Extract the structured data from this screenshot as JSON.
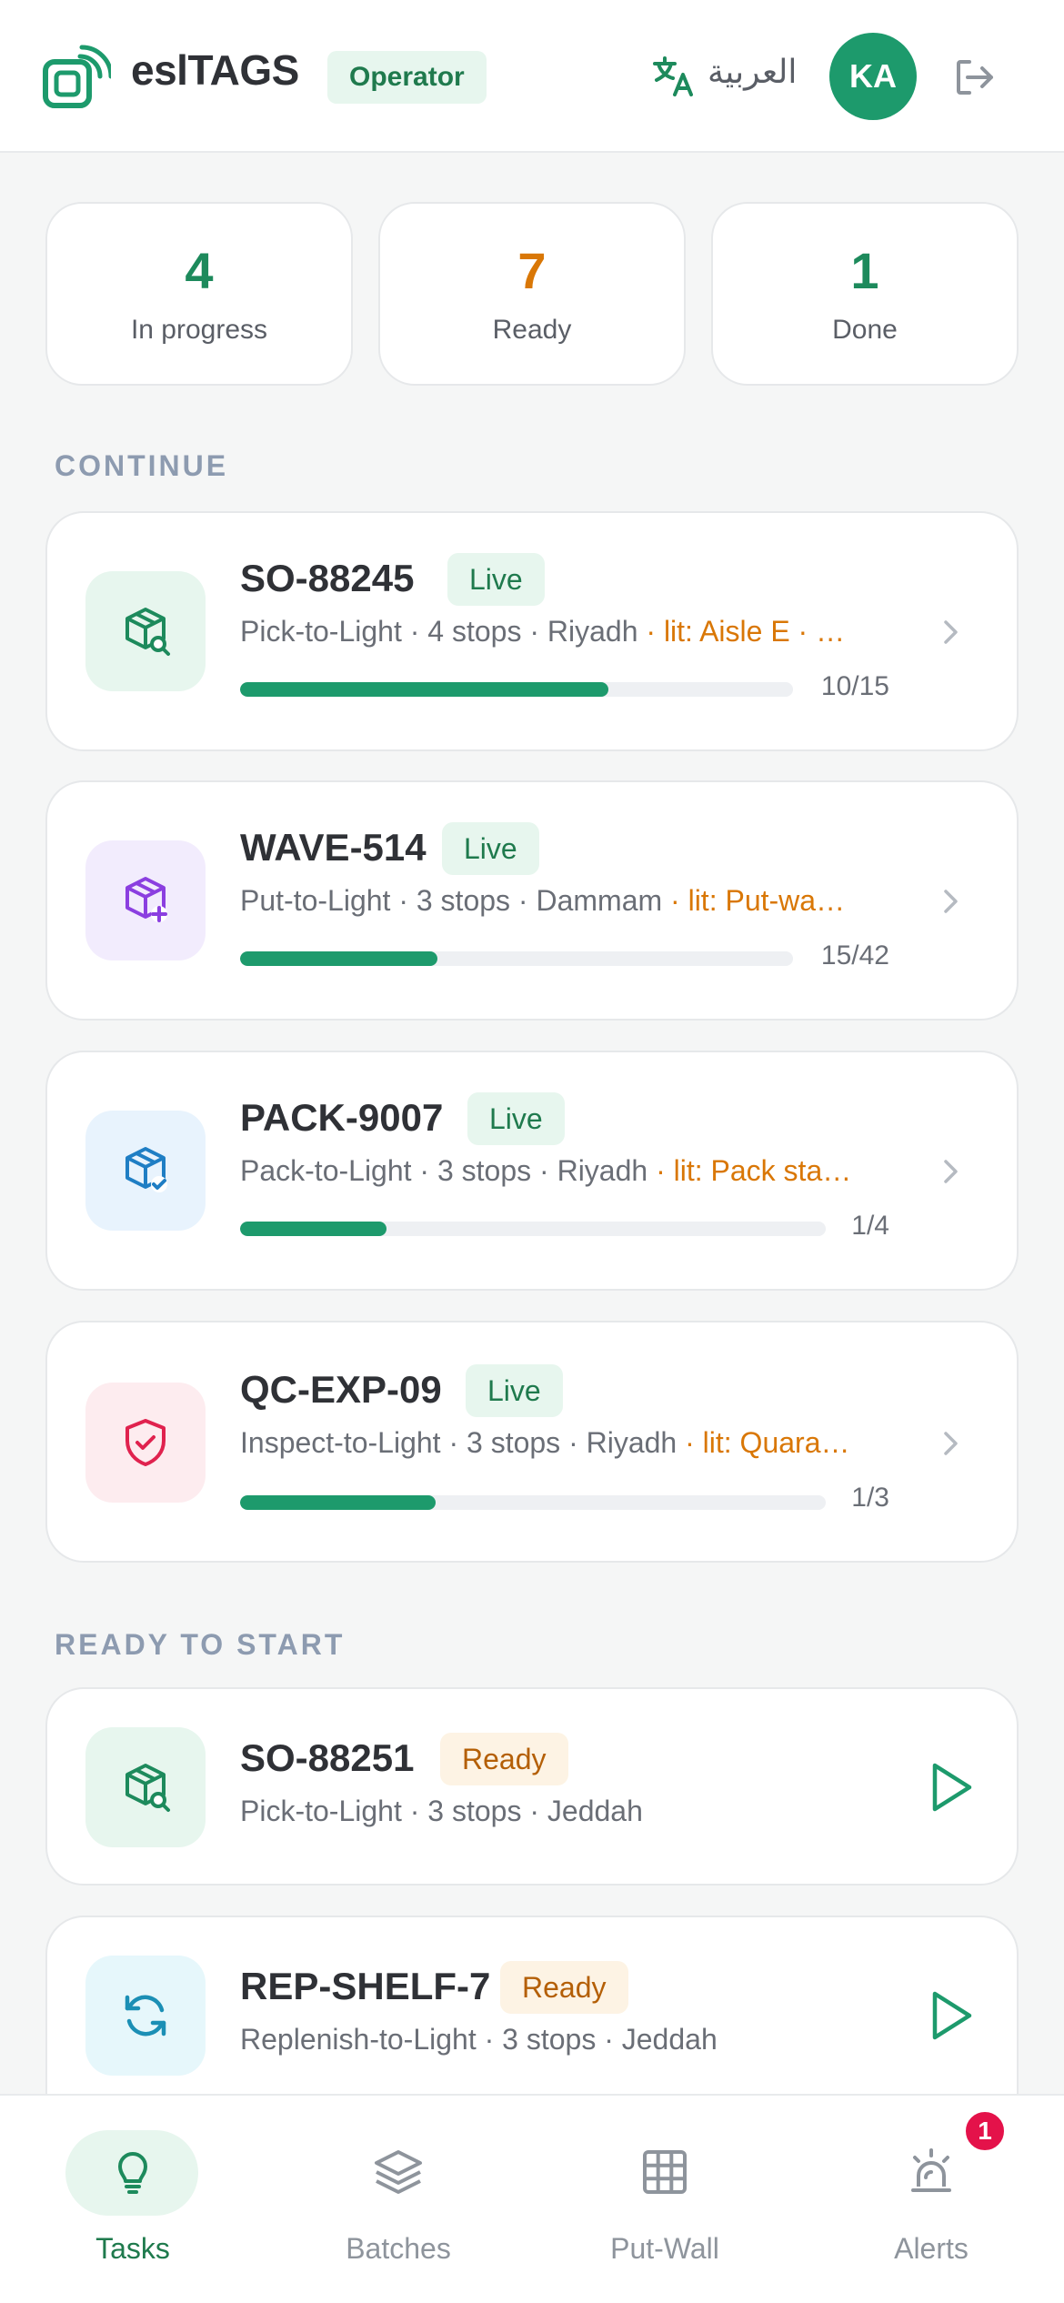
{
  "header": {
    "brand": "eslTAGS",
    "role": "Operator",
    "language": "العربية",
    "avatar_initials": "KA",
    "icons": {
      "logo": "esl-tag-logo-icon",
      "language": "translate-icon",
      "logout": "logout-icon"
    }
  },
  "stats": [
    {
      "value": "4",
      "label": "In progress",
      "color": "#1d8a5c"
    },
    {
      "value": "7",
      "label": "Ready",
      "color": "#d97706"
    },
    {
      "value": "1",
      "label": "Done",
      "color": "#1d8a5c"
    }
  ],
  "sections": {
    "continue": "CONTINUE",
    "ready": "READY TO START"
  },
  "continue_tasks": [
    {
      "id": "SO-88245",
      "status": "Live",
      "mode": "Pick-to-Light",
      "stops": "4 stops",
      "city": "Riyadh",
      "lit": "lit: Aisle E · …",
      "done": 10,
      "total": 15,
      "count": "10/15",
      "icon": "box-search-icon",
      "tint": "#e7f6ee",
      "stroke": "#1d8a5c"
    },
    {
      "id": "WAVE-514",
      "status": "Live",
      "mode": "Put-to-Light",
      "stops": "3 stops",
      "city": "Dammam",
      "lit": "lit: Put-wa…",
      "done": 15,
      "total": 42,
      "count": "15/42",
      "icon": "box-plus-icon",
      "tint": "#f2ecfd",
      "stroke": "#8b3fe0"
    },
    {
      "id": "PACK-9007",
      "status": "Live",
      "mode": "Pack-to-Light",
      "stops": "3 stops",
      "city": "Riyadh",
      "lit": "lit: Pack sta…",
      "done": 1,
      "total": 4,
      "count": "1/4",
      "icon": "box-check-icon",
      "tint": "#e8f3fd",
      "stroke": "#1f7ec4"
    },
    {
      "id": "QC-EXP-09",
      "status": "Live",
      "mode": "Inspect-to-Light",
      "stops": "3 stops",
      "city": "Riyadh",
      "lit": "lit: Quara…",
      "done": 1,
      "total": 3,
      "count": "1/3",
      "icon": "shield-check-icon",
      "tint": "#fdecef",
      "stroke": "#e0224e"
    }
  ],
  "ready_tasks": [
    {
      "id": "SO-88251",
      "status": "Ready",
      "mode": "Pick-to-Light",
      "stops": "3 stops",
      "city": "Jeddah",
      "icon": "box-search-icon",
      "tint": "#e7f6ee",
      "stroke": "#1d8a5c"
    },
    {
      "id": "REP-SHELF-7",
      "status": "Ready",
      "mode": "Replenish-to-Light",
      "stops": "3 stops",
      "city": "Jeddah",
      "icon": "refresh-icon",
      "tint": "#e6f7fb",
      "stroke": "#1b8fb5"
    }
  ],
  "nav": [
    {
      "label": "Tasks",
      "icon": "lightbulb-icon",
      "active": true
    },
    {
      "label": "Batches",
      "icon": "layers-icon",
      "active": false
    },
    {
      "label": "Put-Wall",
      "icon": "grid-icon",
      "active": false
    },
    {
      "label": "Alerts",
      "icon": "siren-icon",
      "active": false,
      "badge": "1"
    }
  ]
}
